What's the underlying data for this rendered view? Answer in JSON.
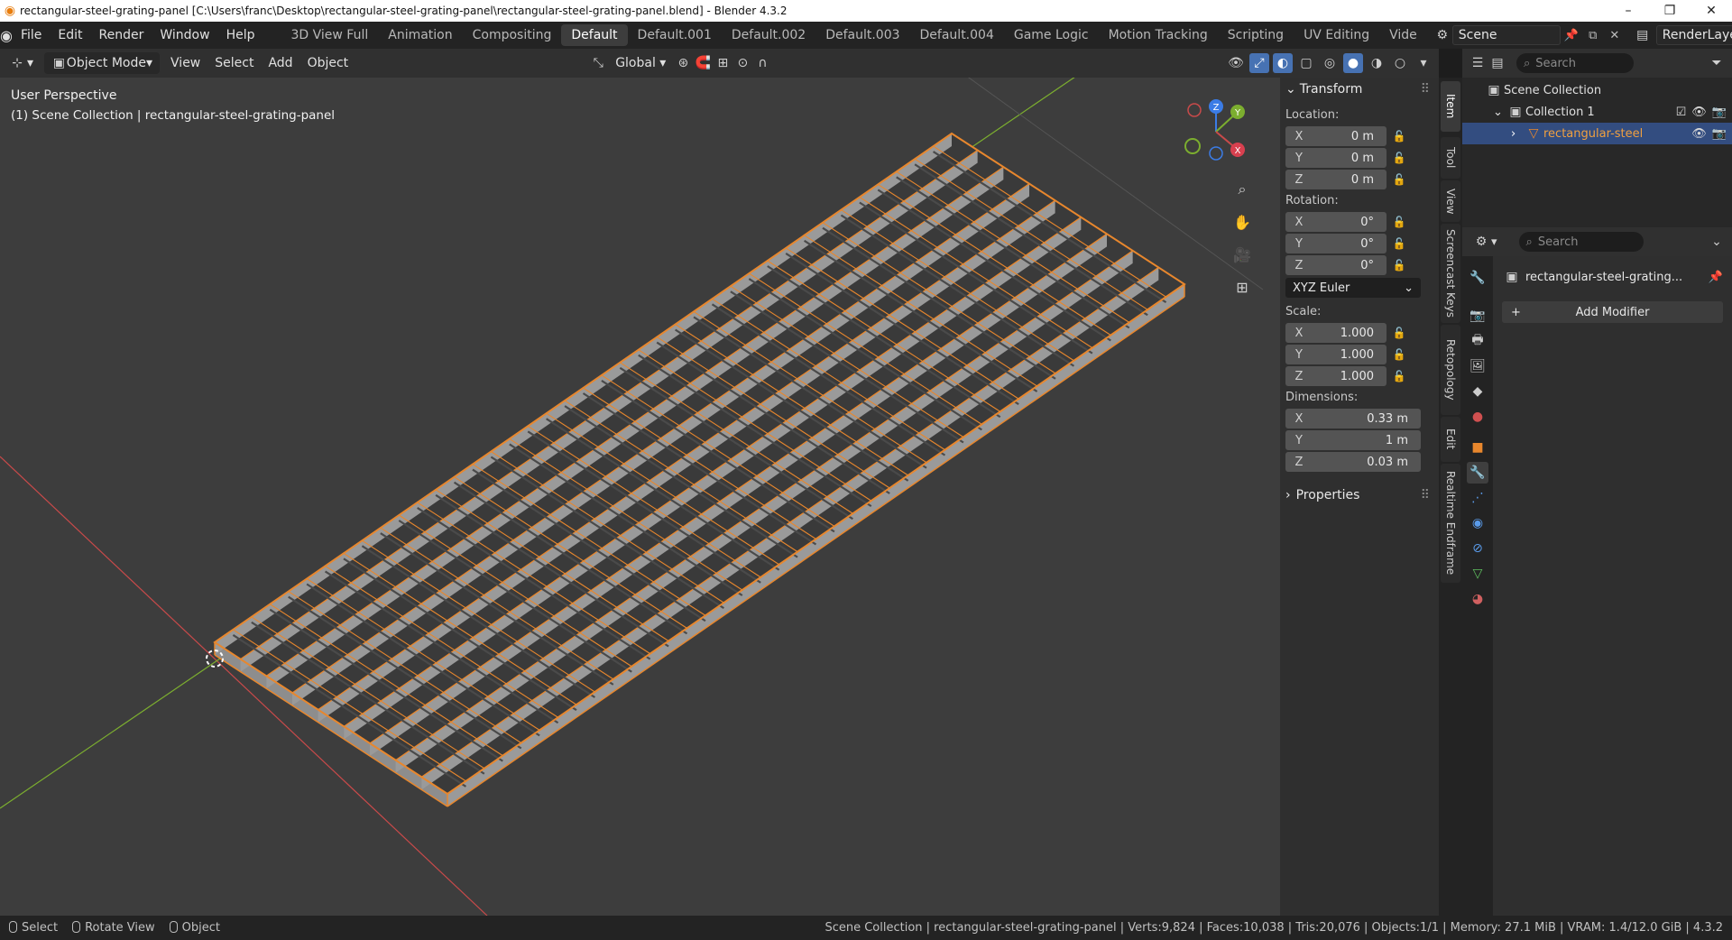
{
  "window": {
    "title": "rectangular-steel-grating-panel [C:\\Users\\franc\\Desktop\\rectangular-steel-grating-panel\\rectangular-steel-grating-panel.blend] - Blender 4.3.2",
    "minimize": "–",
    "maximize": "❐",
    "close": "✕"
  },
  "menu": [
    "File",
    "Edit",
    "Render",
    "Window",
    "Help"
  ],
  "workspaces": [
    "3D View Full",
    "Animation",
    "Compositing",
    "Default",
    "Default.001",
    "Default.002",
    "Default.003",
    "Default.004",
    "Game Logic",
    "Motion Tracking",
    "Scripting",
    "UV Editing",
    "Vide"
  ],
  "active_workspace": "Default",
  "scene": {
    "name": "Scene",
    "view_layer": "RenderLayer"
  },
  "viewport_header": {
    "mode": "Object Mode",
    "menus": [
      "View",
      "Select",
      "Add",
      "Object"
    ],
    "orientation": "Global"
  },
  "viewport": {
    "perspective": "User Perspective",
    "collection_info": "(1) Scene Collection | rectangular-steel-grating-panel",
    "gizmo": {
      "x": "X",
      "y": "Y",
      "z": "Z"
    }
  },
  "npanel": {
    "header": "Transform",
    "location_label": "Location:",
    "location": [
      {
        "axis": "X",
        "value": "0 m"
      },
      {
        "axis": "Y",
        "value": "0 m"
      },
      {
        "axis": "Z",
        "value": "0 m"
      }
    ],
    "rotation_label": "Rotation:",
    "rotation": [
      {
        "axis": "X",
        "value": "0°"
      },
      {
        "axis": "Y",
        "value": "0°"
      },
      {
        "axis": "Z",
        "value": "0°"
      }
    ],
    "rotation_mode": "XYZ Euler",
    "scale_label": "Scale:",
    "scale": [
      {
        "axis": "X",
        "value": "1.000"
      },
      {
        "axis": "Y",
        "value": "1.000"
      },
      {
        "axis": "Z",
        "value": "1.000"
      }
    ],
    "dimensions_label": "Dimensions:",
    "dimensions": [
      {
        "axis": "X",
        "value": "0.33 m"
      },
      {
        "axis": "Y",
        "value": "1 m"
      },
      {
        "axis": "Z",
        "value": "0.03 m"
      }
    ],
    "properties_header": "Properties"
  },
  "side_tabs": [
    "Item",
    "Tool",
    "View",
    "Screencast Keys",
    "Retopology",
    "Edit",
    "Realtime Endframe"
  ],
  "outliner": {
    "search_placeholder": "Search",
    "scene_collection": "Scene Collection",
    "collection": "Collection 1",
    "object": "rectangular-steel"
  },
  "properties": {
    "search_placeholder": "Search",
    "object_name": "rectangular-steel-grating...",
    "add_modifier": "Add Modifier"
  },
  "statusbar": {
    "select": "Select",
    "rotate": "Rotate View",
    "object": "Object",
    "stats": "Scene Collection | rectangular-steel-grating-panel | Verts:9,824 | Faces:10,038 | Tris:20,076 | Objects:1/1 | Memory: 27.1 MiB | VRAM: 1.4/12.0 GiB | 4.3.2"
  },
  "colors": {
    "accent": "#4772b3",
    "selection": "#e8872d",
    "viewport_bg": "#3d3d3d",
    "x_axis": "#c94a4a",
    "y_axis": "#7cae2f",
    "z_axis": "#3b7ce6"
  }
}
